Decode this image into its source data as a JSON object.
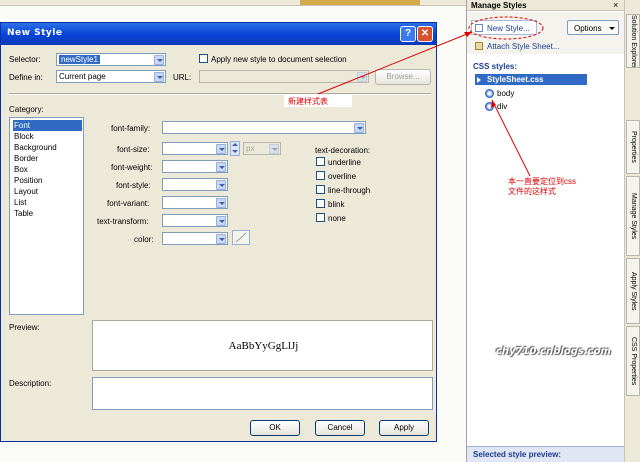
{
  "dialog": {
    "title": "New Style",
    "help_glyph": "?",
    "close_glyph": "✕",
    "selector_label": "Selector:",
    "selector_value": "newStyle1",
    "apply_checkbox_label": "Apply new style to document selection",
    "define_in_label": "Define in:",
    "define_in_value": "Current page",
    "url_label": "URL:",
    "url_value": "",
    "browse_button": "Browse...",
    "category_label": "Category:",
    "categories": [
      "Font",
      "Block",
      "Background",
      "Border",
      "Box",
      "Position",
      "Layout",
      "List",
      "Table"
    ],
    "selected_category": "Font",
    "font_fields": {
      "font_family": "font-family:",
      "font_size": "font-size:",
      "font_weight": "font-weight:",
      "font_style": "font-style:",
      "font_variant": "font-variant:",
      "text_transform": "text-transform:",
      "color": "color:",
      "size_unit": "px"
    },
    "text_decoration": {
      "label": "text-decoration:",
      "options": [
        "underline",
        "overline",
        "line-through",
        "blink",
        "none"
      ]
    },
    "preview_label": "Preview:",
    "preview_text": "AaBbYyGgLlJj",
    "description_label": "Description:",
    "ok_button": "OK",
    "cancel_button": "Cancel",
    "apply_button": "Apply"
  },
  "panel": {
    "title": "Manage Styles",
    "close_glyph": "×",
    "new_style_button": "New Style...",
    "options_button": "Options",
    "attach_button": "Attach Style Sheet...",
    "css_styles_label": "CSS styles:",
    "stylesheet": "StyleSheet.css",
    "rules": [
      "body",
      "div"
    ],
    "footer": "Selected style preview:"
  },
  "side_tabs": [
    "Solution Explorer",
    "Properties",
    "Manage Styles",
    "Apply Styles",
    "CSS Properties"
  ],
  "annotations": {
    "new_stylesheet_note": "新建样式表",
    "locate_note_line1": "本一直要定位到css",
    "locate_note_line2": "文件的这样式",
    "watermark": "chy710.cnblogs.com"
  },
  "colors": {
    "titlebar": "#0a46d8",
    "selection": "#316ac5",
    "annotation": "#e00000"
  }
}
